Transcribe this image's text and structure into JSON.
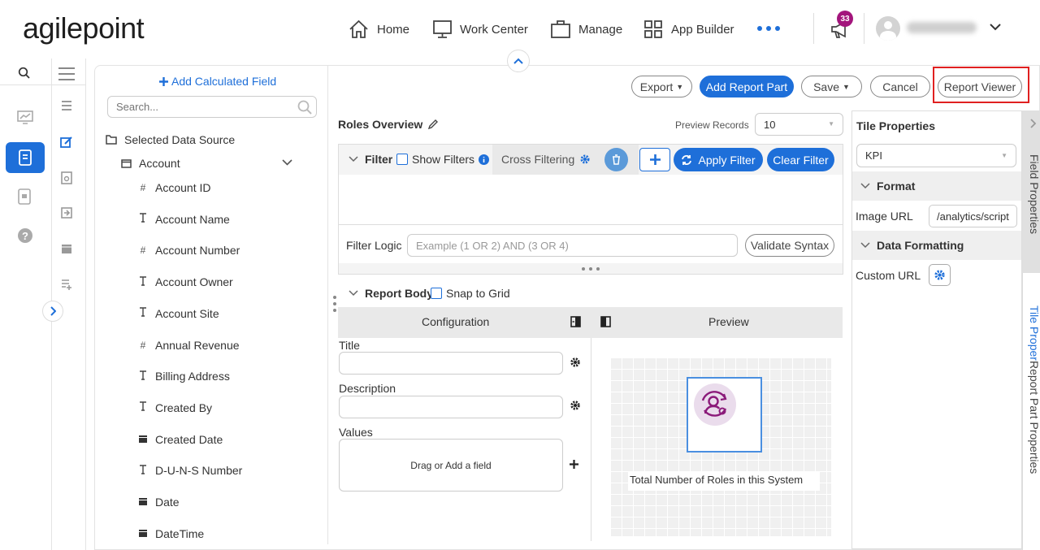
{
  "header": {
    "logo": "agilepoint",
    "nav": [
      {
        "label": "Home",
        "icon": "home-icon"
      },
      {
        "label": "Work Center",
        "icon": "monitor-icon"
      },
      {
        "label": "Manage",
        "icon": "briefcase-icon"
      },
      {
        "label": "App Builder",
        "icon": "grid-icon"
      }
    ],
    "more": "more-icon",
    "notification_count": "33",
    "user_name": "(blurred)"
  },
  "left_panel": {
    "add_calculated_field": "Add Calculated Field",
    "search_placeholder": "Search...",
    "data_source_label": "Selected Data Source",
    "entity": "Account",
    "fields": [
      {
        "icon": "#",
        "name": "Account ID"
      },
      {
        "icon": "T",
        "name": "Account Name"
      },
      {
        "icon": "#",
        "name": "Account Number"
      },
      {
        "icon": "T",
        "name": "Account Owner"
      },
      {
        "icon": "T",
        "name": "Account Site"
      },
      {
        "icon": "#",
        "name": "Annual Revenue"
      },
      {
        "icon": "T",
        "name": "Billing Address"
      },
      {
        "icon": "T",
        "name": "Created By"
      },
      {
        "icon": "cal",
        "name": "Created Date"
      },
      {
        "icon": "T",
        "name": "D-U-N-S Number"
      },
      {
        "icon": "cal",
        "name": "Date"
      },
      {
        "icon": "cal",
        "name": "DateTime"
      }
    ]
  },
  "toolbar": {
    "export": "Export",
    "add_report_part": "Add Report Part",
    "save": "Save",
    "cancel": "Cancel",
    "report_viewer": "Report Viewer"
  },
  "report": {
    "title": "Roles Overview",
    "preview_records_label": "Preview Records",
    "preview_records_value": "10"
  },
  "filter": {
    "label": "Filter",
    "show_filters": "Show Filters",
    "cross_filtering": "Cross Filtering",
    "apply_filter": "Apply Filter",
    "clear_filter": "Clear Filter",
    "filter_logic_label": "Filter Logic",
    "filter_logic_placeholder": "Example (1 OR 2) AND (3 OR 4)",
    "validate_syntax": "Validate Syntax"
  },
  "report_body": {
    "label": "Report Body",
    "snap_to_grid": "Snap to Grid",
    "configuration": "Configuration",
    "preview": "Preview",
    "title_label": "Title",
    "description_label": "Description",
    "values_label": "Values",
    "values_placeholder": "Drag or Add a field",
    "kpi_caption": "Total Number of Roles in this System"
  },
  "tile_properties": {
    "header": "Tile Properties",
    "type_value": "KPI",
    "format_section": "Format",
    "image_url_label": "Image URL",
    "image_url_value": "/analytics/script",
    "data_formatting_section": "Data Formatting",
    "custom_url_label": "Custom URL"
  },
  "side_tabs": {
    "field_properties": "Field Properties",
    "tile_properties": "Tile Proper",
    "report_part_properties": "Report Part Properties"
  },
  "colors": {
    "accent": "#1e6fd9",
    "badge": "#a3157c",
    "highlight": "#e02020",
    "kpi_icon": "#8b1a7a"
  }
}
